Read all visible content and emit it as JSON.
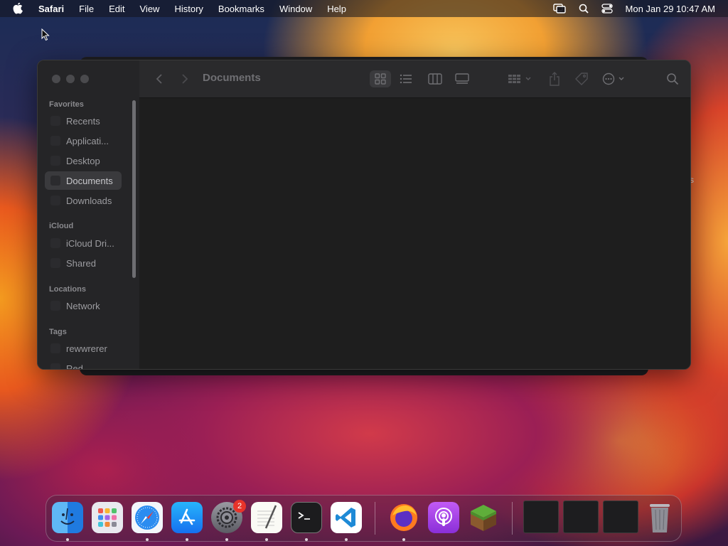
{
  "menubar": {
    "app_name": "Safari",
    "items": [
      "File",
      "Edit",
      "View",
      "History",
      "Bookmarks",
      "Window",
      "Help"
    ],
    "clock": "Mon Jan 29  10:47 AM"
  },
  "finder": {
    "title": "Documents",
    "sidebar": {
      "favorites_header": "Favorites",
      "favorites": [
        "Recents",
        "Applicati...",
        "Desktop",
        "Documents",
        "Downloads"
      ],
      "icloud_header": "iCloud",
      "icloud": [
        "iCloud Dri...",
        "Shared"
      ],
      "locations_header": "Locations",
      "locations": [
        "Network"
      ],
      "tags_header": "Tags",
      "tags": [
        "rewwrerer",
        "Red"
      ]
    }
  },
  "background_window": {
    "stray_text": "s"
  },
  "dock": {
    "apps": [
      "finder-icon",
      "launchpad-icon",
      "safari-icon",
      "app-store-icon",
      "system-settings-icon",
      "textedit-icon",
      "terminal-icon",
      "vscode-icon",
      "firefox-icon",
      "podcasts-icon",
      "minecraft-icon"
    ],
    "settings_badge": "2"
  },
  "colors": {
    "window_bg": "#1e1e1e",
    "sidebar_bg": "#252527",
    "toolbar_bg": "#2a2a2c",
    "badge": "#e8332a"
  }
}
